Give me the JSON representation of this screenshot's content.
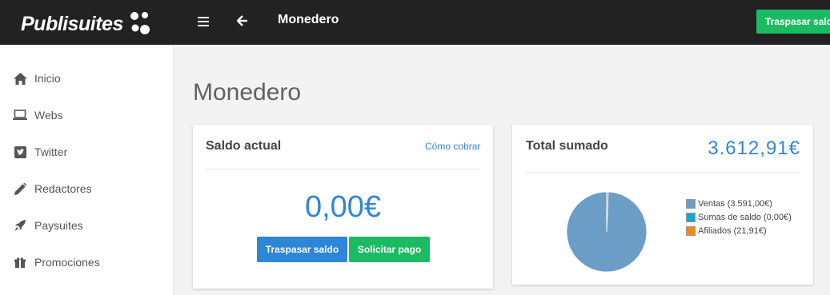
{
  "app": {
    "logo_text": "Publisuites",
    "page_header": "Monedero",
    "top_action_label": "Traspasar saldo"
  },
  "sidebar": {
    "items": [
      {
        "label": "Inicio",
        "icon": "home-icon"
      },
      {
        "label": "Webs",
        "icon": "laptop-icon"
      },
      {
        "label": "Twitter",
        "icon": "twitter-icon"
      },
      {
        "label": "Redactores",
        "icon": "pencil-icon"
      },
      {
        "label": "Paysuites",
        "icon": "rocket-icon"
      },
      {
        "label": "Promociones",
        "icon": "gift-icon"
      }
    ]
  },
  "main": {
    "title": "Monedero",
    "saldo_card": {
      "title": "Saldo actual",
      "link": "Cómo cobrar",
      "amount": "0,00€",
      "transfer_button": "Traspasar saldo",
      "request_button": "Solicitar pago"
    },
    "total_card": {
      "title": "Total sumado",
      "amount": "3.612,91€",
      "legend": [
        {
          "label": "Ventas (3.591,00€)",
          "color": "#6b9dc7"
        },
        {
          "label": "Sumas de saldo (0,00€)",
          "color": "#13a8d4"
        },
        {
          "label": "Afiliados (21,91€)",
          "color": "#f28b0c"
        }
      ]
    }
  },
  "colors": {
    "accent_blue": "#2f86d6",
    "accent_green": "#1cbb63",
    "topbar": "#222222"
  },
  "chart_data": {
    "type": "pie",
    "categories": [
      "Ventas (3.591,00€)",
      "Sumas de saldo (0,00€)",
      "Afiliados (21,91€)"
    ],
    "values": [
      3591.0,
      0.0,
      21.91
    ],
    "colors": [
      "#6b9dc7",
      "#13a8d4",
      "#f28b0c"
    ],
    "legend": "right"
  }
}
